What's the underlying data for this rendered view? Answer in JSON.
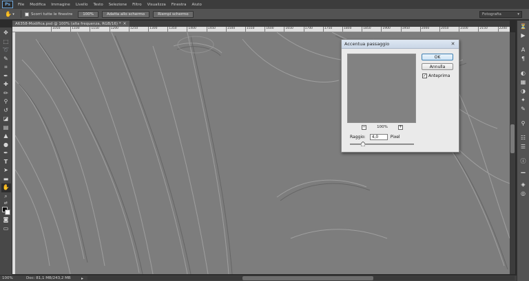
{
  "app": {
    "logo": "Ps"
  },
  "menu": [
    "File",
    "Modifica",
    "Immagine",
    "Livello",
    "Testo",
    "Selezione",
    "Filtro",
    "Visualizza",
    "Finestra",
    "Aiuto"
  ],
  "options_bar": {
    "checkbox_label": "Scorri tutte le finestre",
    "buttons": [
      "100%",
      "Adatta allo schermo",
      "Riempi schermo"
    ],
    "workspace": "Fotografia"
  },
  "document_tab": {
    "title": "A6358-Modifica.psd @ 100% (alta frequenza, RGB/16) *"
  },
  "ruler": {
    "ticks": [
      "1050",
      "1100",
      "1150",
      "1200",
      "1250",
      "1300",
      "1350",
      "1400",
      "1450",
      "1500",
      "1550",
      "1600",
      "1650",
      "1700",
      "1750",
      "1800",
      "1850",
      "1900",
      "1950",
      "2000",
      "2050",
      "2100",
      "2150",
      "2200",
      "2250"
    ]
  },
  "status_bar": {
    "zoom": "100%",
    "doc_info": "Doc: 81,1 MB/243,2 MB"
  },
  "dialog": {
    "title": "Accentua passaggio",
    "ok": "OK",
    "cancel": "Annulla",
    "preview_label": "Anteprima",
    "preview_checked": true,
    "preview_zoom": "100%",
    "radius_label": "Raggio:",
    "radius_value": "4,0",
    "radius_unit": "Pixel"
  },
  "colors": {
    "canvas": "#7d7d7d",
    "panel": "#535353",
    "ok_border": "#3c7fb1"
  }
}
